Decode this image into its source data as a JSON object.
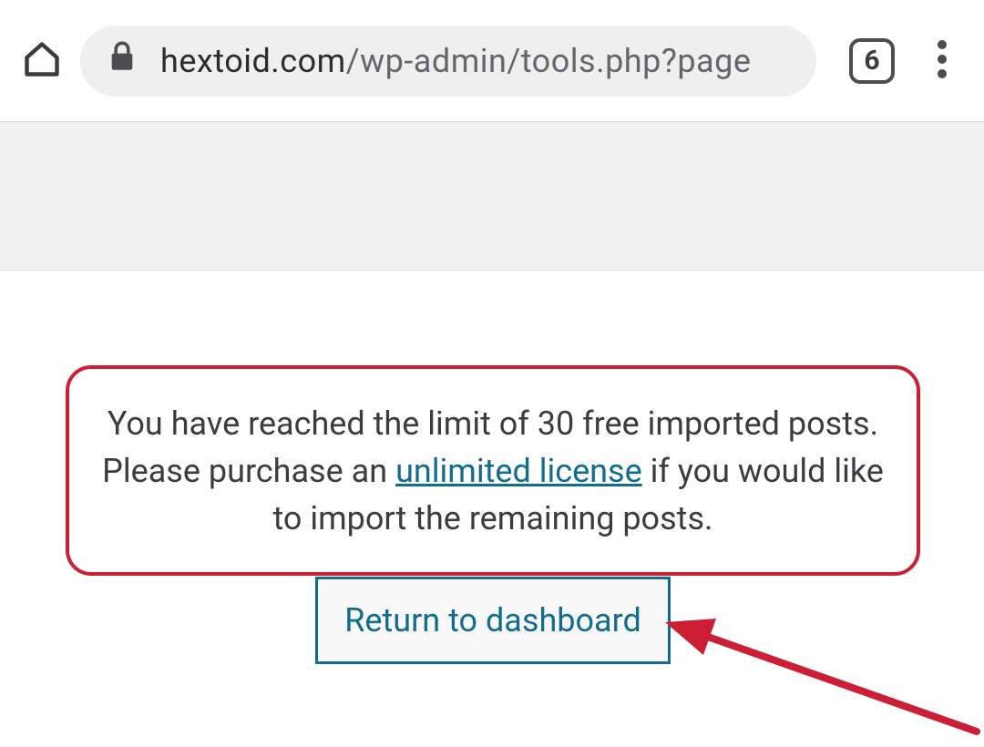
{
  "browser": {
    "url_domain": "hextoid.com",
    "url_rest": "/wp-admin/tools.php?page",
    "tab_count": "6"
  },
  "notice": {
    "text_before_link": "You have reached the limit of 30 free imported posts. Please purchase an ",
    "link_text": "unlimited license",
    "text_after_link": " if you would like to import the remaining posts."
  },
  "button": {
    "return_label": "Return to dashboard"
  },
  "colors": {
    "highlight_red": "#cc1f36",
    "accent_teal": "#126c8e"
  }
}
